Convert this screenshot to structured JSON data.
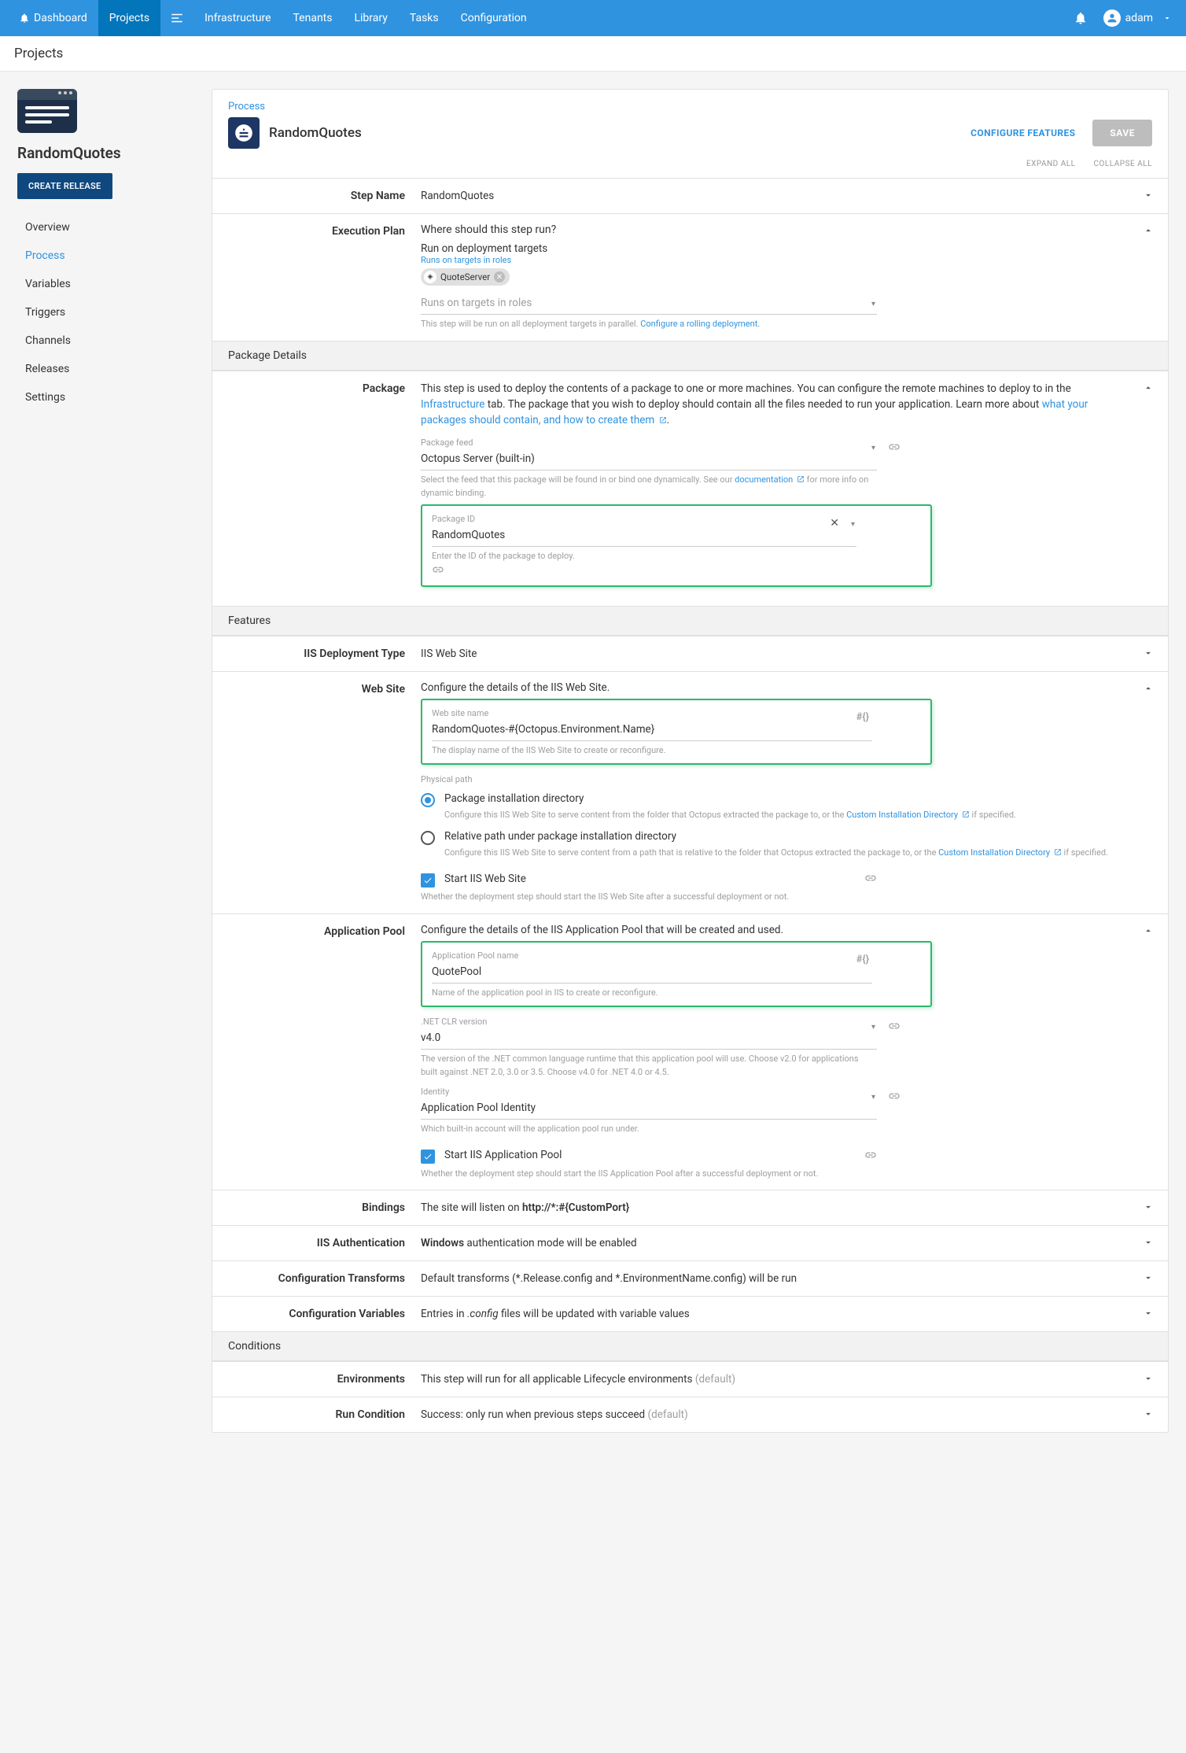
{
  "nav": {
    "items": [
      "Dashboard",
      "Projects",
      "Infrastructure",
      "Tenants",
      "Library",
      "Tasks",
      "Configuration"
    ],
    "user": "adam"
  },
  "page_title": "Projects",
  "sidebar": {
    "project_name": "RandomQuotes",
    "create_release": "CREATE RELEASE",
    "items": [
      "Overview",
      "Process",
      "Variables",
      "Triggers",
      "Channels",
      "Releases",
      "Settings"
    ]
  },
  "header": {
    "breadcrumb": "Process",
    "step_title": "RandomQuotes",
    "configure_features": "CONFIGURE FEATURES",
    "save": "SAVE",
    "expand_all": "EXPAND ALL",
    "collapse_all": "COLLAPSE ALL"
  },
  "step_name": {
    "label": "Step Name",
    "value": "RandomQuotes"
  },
  "execution_plan": {
    "label": "Execution Plan",
    "question": "Where should this step run?",
    "run_on": "Run on deployment targets",
    "link": "Runs on targets in roles",
    "chip": "QuoteServer",
    "select_placeholder": "Runs on targets in roles",
    "help": "This step will be run on all deployment targets in parallel.",
    "help_link": "Configure a rolling deployment."
  },
  "package_details": {
    "header": "Package Details",
    "label": "Package",
    "desc1": "This step is used to deploy the contents of a package to one or more machines. You can configure the remote machines to deploy to in the ",
    "desc1_link": "Infrastructure",
    "desc1_b": " tab. The package that you wish to deploy should contain all the files needed to run your application. Learn more about ",
    "desc1_link2": "what your packages should contain, and how to create them ",
    "feed_label": "Package feed",
    "feed_value": "Octopus Server (built-in)",
    "feed_help": "Select the feed that this package will be found in or bind one dynamically. See our ",
    "feed_help_link": "documentation ",
    "feed_help_b": " for more info on dynamic binding.",
    "id_label": "Package ID",
    "id_value": "RandomQuotes",
    "id_help": "Enter the ID of the package to deploy."
  },
  "features": {
    "header": "Features"
  },
  "iis_type": {
    "label": "IIS Deployment Type",
    "value": "IIS Web Site"
  },
  "website": {
    "label": "Web Site",
    "desc": "Configure the details of the IIS Web Site.",
    "name_label": "Web site name",
    "name_value": "RandomQuotes-#{Octopus.Environment.Name}",
    "name_help": "The display name of the IIS Web Site to create or reconfigure.",
    "phys_label": "Physical path",
    "opt1": "Package installation directory",
    "opt1_help_a": "Configure this IIS Web Site to serve content from the folder that Octopus extracted the package to, or the ",
    "opt1_help_link": "Custom Installation Directory ",
    "opt1_help_b": " if specified.",
    "opt2": "Relative path under package installation directory",
    "opt2_help_a": "Configure this IIS Web Site to serve content from a path that is relative to the folder that Octopus extracted the package to, or the ",
    "opt2_help_link": "Custom Installation Directory ",
    "opt2_help_b": " if specified.",
    "start": "Start IIS Web Site",
    "start_help": "Whether the deployment step should start the IIS Web Site after a successful deployment or not."
  },
  "apppool": {
    "label": "Application Pool",
    "desc": "Configure the details of the IIS Application Pool that will be created and used.",
    "name_label": "Application Pool name",
    "name_value": "QuotePool",
    "name_help": "Name of the application pool in IIS to create or reconfigure.",
    "clr_label": ".NET CLR version",
    "clr_value": "v4.0",
    "clr_help": "The version of the .NET common language runtime that this application pool will use. Choose v2.0 for applications built against .NET 2.0, 3.0 or 3.5. Choose v4.0 for .NET 4.0 or 4.5.",
    "id_label": "Identity",
    "id_value": "Application Pool Identity",
    "id_help": "Which built-in account will the application pool run under.",
    "start": "Start IIS Application Pool",
    "start_help": "Whether the deployment step should start the IIS Application Pool after a successful deployment or not."
  },
  "bindings": {
    "label": "Bindings",
    "pre": "The site will listen on ",
    "value": "http://*:#{CustomPort}"
  },
  "iis_auth": {
    "label": "IIS Authentication",
    "bold": "Windows",
    "rest": " authentication mode will be enabled"
  },
  "cfg_trans": {
    "label": "Configuration Transforms",
    "value": "Default transforms (*.Release.config and *.EnvironmentName.config) will be run"
  },
  "cfg_vars": {
    "label": "Configuration Variables",
    "pre": "Entries in ",
    "em": ".config",
    "post": " files will be updated with variable values"
  },
  "conditions": {
    "header": "Conditions"
  },
  "env": {
    "label": "Environments",
    "text": "This step will run for all applicable Lifecycle environments ",
    "def": "(default)"
  },
  "runcond": {
    "label": "Run Condition",
    "text": "Success: only run when previous steps succeed ",
    "def": "(default)"
  }
}
